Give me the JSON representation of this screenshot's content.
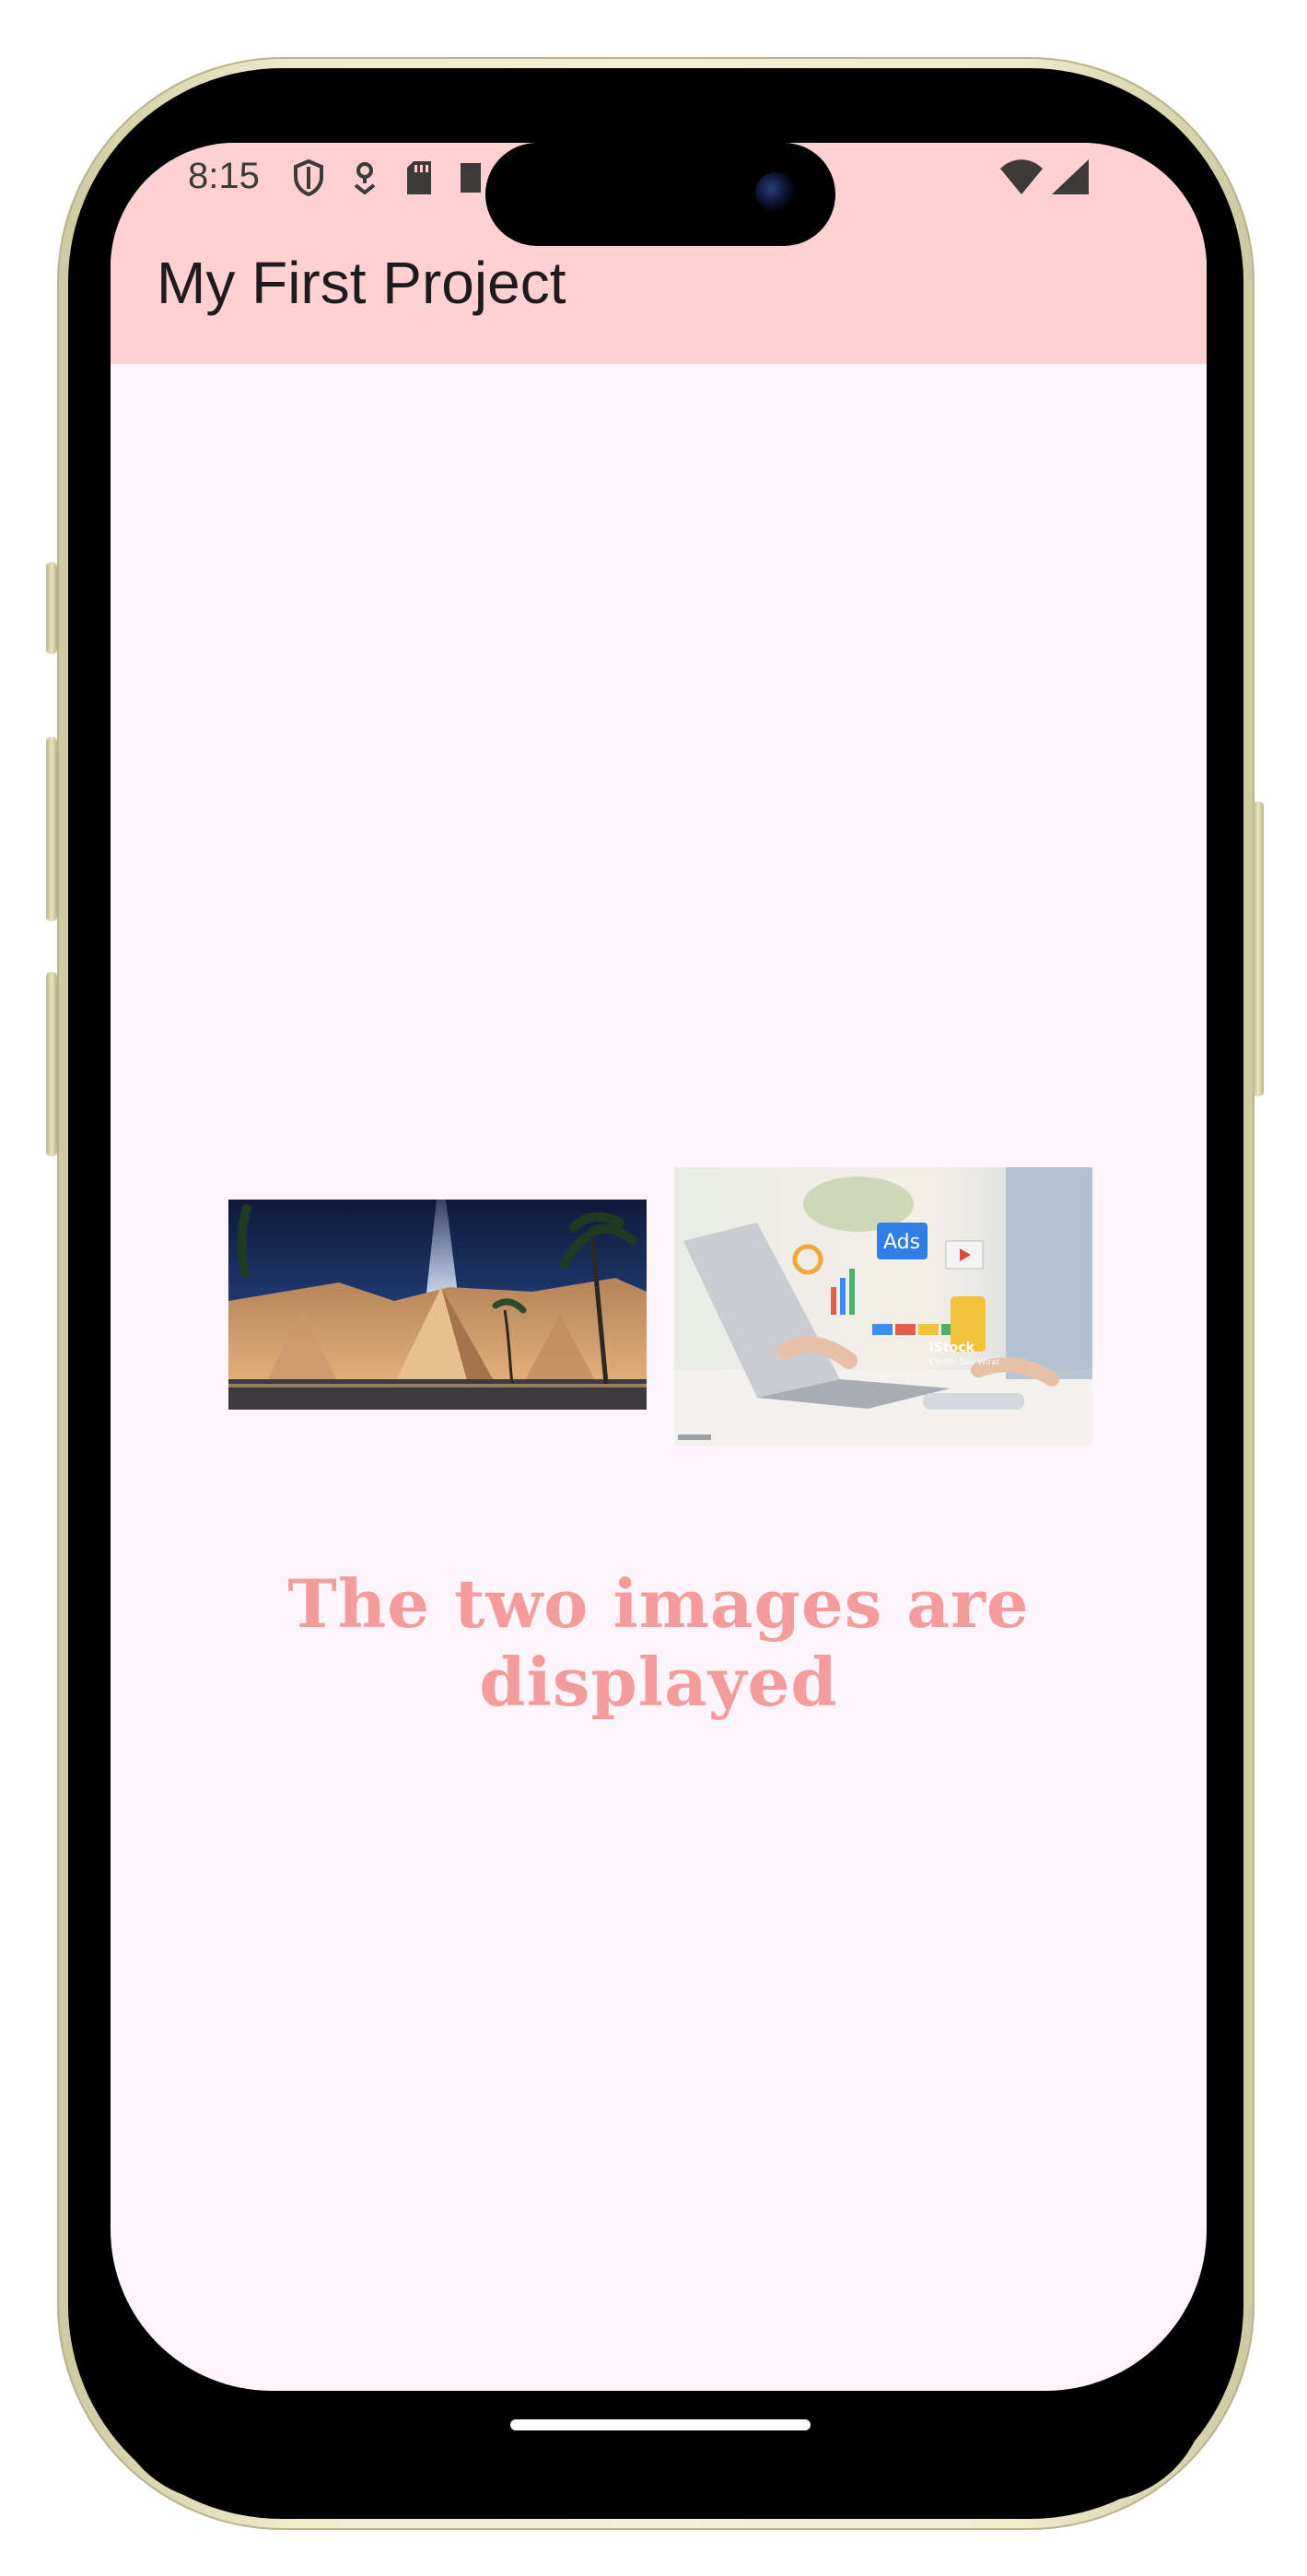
{
  "status_bar": {
    "time": "8:15",
    "left_icons": [
      "shield-icon",
      "location-icon",
      "sd-card-icon",
      "square-icon"
    ],
    "right_icons": [
      "wifi-icon",
      "cellular-signal-icon"
    ]
  },
  "app_bar": {
    "title": "My First Project",
    "background_color": "#ffd1d2"
  },
  "content": {
    "images": [
      {
        "name": "museum-image",
        "depicts": "pyramid-shaped museum at night"
      },
      {
        "name": "ads-image",
        "depicts": "laptop with digital ads interface",
        "watermark": "iStock",
        "watermark_credit": "Credit: Say Wirat"
      }
    ],
    "caption": "The two images are displayed",
    "caption_color": "#f49c9b",
    "background_color": "#fdf4fc"
  }
}
